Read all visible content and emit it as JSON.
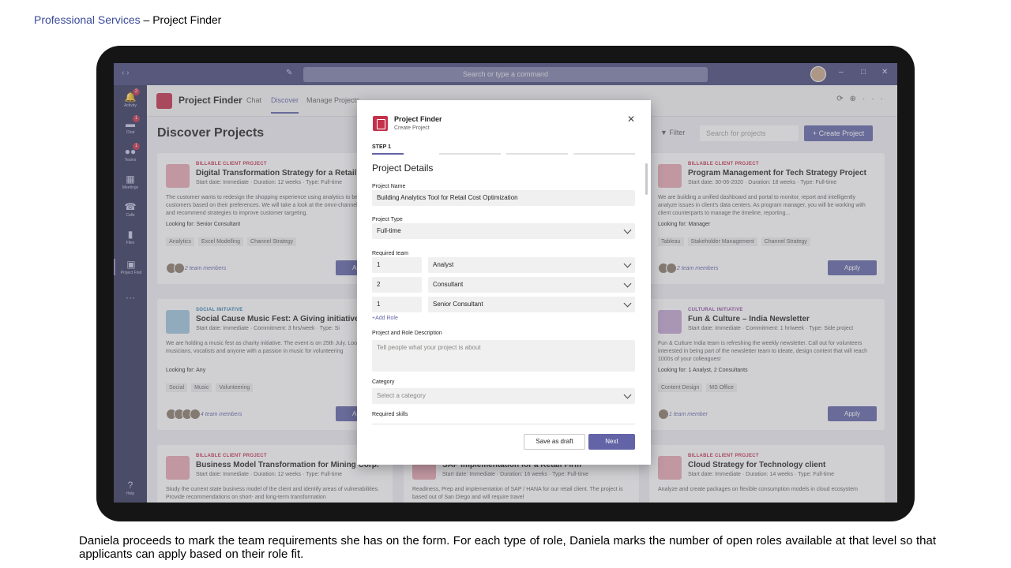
{
  "slide": {
    "title_accent": "Professional Services",
    "title_rest": " – Project Finder",
    "caption": "Daniela proceeds to mark the team requirements she has on the form. For each type of role, Daniela marks the number of open roles available at that level so that applicants can apply based on their role fit."
  },
  "teams": {
    "command_placeholder": "Search or type a command",
    "rail": [
      {
        "icon": "bell-icon",
        "label": "Activity",
        "badge": "2"
      },
      {
        "icon": "chat-icon",
        "label": "Chat",
        "badge": "1"
      },
      {
        "icon": "teams-icon",
        "label": "Teams",
        "badge": "1"
      },
      {
        "icon": "calendar-icon",
        "label": "Meetings",
        "badge": ""
      },
      {
        "icon": "phone-icon",
        "label": "Calls",
        "badge": ""
      },
      {
        "icon": "file-icon",
        "label": "Files",
        "badge": ""
      },
      {
        "icon": "project-find-icon",
        "label": "Project Find",
        "badge": ""
      }
    ],
    "help_label": "Help",
    "app_name": "Project Finder",
    "tabs": [
      "Chat",
      "Discover",
      "Manage Projects"
    ],
    "active_tab": "Discover"
  },
  "discover": {
    "title": "Discover Projects",
    "filter_label": "Filter",
    "search_placeholder": "Search for projects",
    "create_label": "+ Create Project",
    "apply_label": "Apply",
    "cards": [
      {
        "kind": "BILLABLE CLIENT PROJECT",
        "title": "Digital Transformation Strategy for a Retail Gia",
        "meta": "Start date: Immediate · Duration: 12 weeks · Type: Full-time",
        "desc": "The customer wants to redesign the shopping experience using analytics to better serve customers based on their preferences. We will take a look at the omni-channel approach and recommend strategies to improve customer targeting.",
        "looking_for": "Looking for: Senior Consultant",
        "tags": [
          "Analytics",
          "Excel Modelling",
          "Channel Strategy"
        ],
        "members": "2 team members"
      },
      {
        "kind": "BILLABLE CLIENT PROJECT",
        "title": "Program Management for Tech Strategy Project",
        "meta": "Start date: 30-06-2020 · Duration: 18 weeks · Type: Full-time",
        "desc": "We are building a unified dashboard and portal to monitor, report and intelligently analyze issues in client's data centers. As program manager, you will be working with client counterparts to manage the timeline, reporting...",
        "looking_for": "Looking for: Manager",
        "tags": [
          "Tableau",
          "Stakeholder Management",
          "Channel Strategy"
        ],
        "members": "2 team members"
      },
      {
        "kind": "SOCIAL INITIATIVE",
        "title": "Social Cause Music Fest: A Giving initiative",
        "meta": "Start date: Immediate · Commitment: 3 hrs/week · Type: Si",
        "desc": "We are holding a music fest as charity initiative. The event is on 25th July. Looking for musicians, vocalists and anyone with a passion in music for volunteering",
        "looking_for": "Looking for: Any",
        "tags": [
          "Social",
          "Music",
          "Volunteering"
        ],
        "members": "4 team members"
      },
      {
        "kind": "CULTURAL INITIATIVE",
        "title": "Fun & Culture – India Newsletter",
        "meta": "Start date: Immediate · Commitment: 1 hr/week · Type: Side project",
        "desc": "Fun & Culture India team is refreshing the weekly newsletter. Call out for volunteers interested in being part of the newsletter team to ideate, design content that will reach 1000s of your colleagues!",
        "looking_for": "Looking for: 1 Analyst, 2 Consultants",
        "tags": [
          "Content Design",
          "MS Office"
        ],
        "members": "1 team member"
      },
      {
        "kind": "BILLABLE CLIENT PROJECT",
        "title": "Business Model Transformation for Mining Corp.",
        "meta": "Start date: Immediate · Duration: 12 weeks · Type: Full-time",
        "desc": "Study the current state business model of the client and identify areas of vulnerabilities. Provide recommendations on short- and long-term transformation"
      },
      {
        "kind": "BILLABLE CLIENT PROJECT",
        "title": "SAP Implementation for a Retail Firm",
        "meta": "Start date: Immediate · Duration: 16 weeks · Type: Full-time",
        "desc": "Readiness, Prep and implementation of SAP / HANA for our retail client. The project is based out of San Diego and will require travel"
      },
      {
        "kind": "BILLABLE CLIENT PROJECT",
        "title": "Cloud Strategy for Technology client",
        "meta": "Start date: Immediate · Duration: 14 weeks · Type: Full-time",
        "desc": "Analyze and create packages on flexible consumption models in cloud ecosystem"
      }
    ]
  },
  "modal": {
    "app_name": "Project Finder",
    "subtitle": "Create Project",
    "step_label": "STEP 1",
    "section_title": "Project Details",
    "project_name_label": "Project Name",
    "project_name_value": "Building Analytics Tool for Retail Cost Optimization",
    "project_type_label": "Project Type",
    "project_type_value": "Full-time",
    "required_team_label": "Required team",
    "team": [
      {
        "count": "1",
        "role": "Analyst"
      },
      {
        "count": "2",
        "role": "Consultant"
      },
      {
        "count": "1",
        "role": "Senior Consultant"
      }
    ],
    "add_role_label": "+Add Role",
    "description_label": "Project and Role Description",
    "description_placeholder": "Tell people what your project is about",
    "category_label": "Category",
    "category_placeholder": "Select a category",
    "skills_label": "Required skills",
    "save_draft_label": "Save as draft",
    "next_label": "Next"
  }
}
